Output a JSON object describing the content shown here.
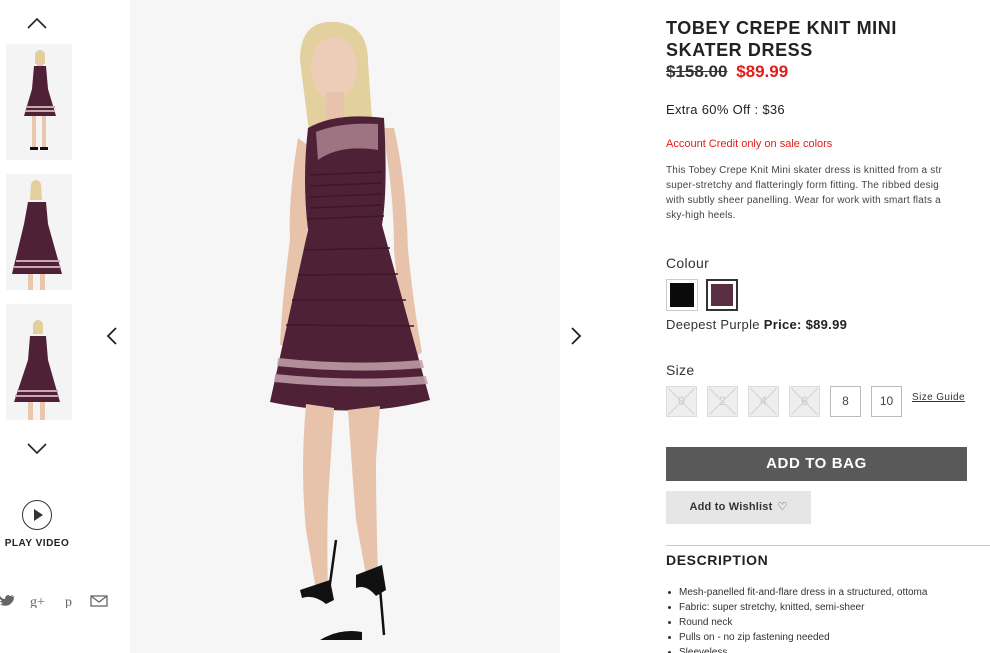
{
  "rail": {
    "icons": {
      "up": "chevron-up-icon",
      "down": "chevron-down-icon"
    },
    "thumbnails": [
      {
        "alt": "front-view"
      },
      {
        "alt": "side-view"
      },
      {
        "alt": "three-quarter-view"
      }
    ],
    "play_video_label": "PLAY VIDEO",
    "social_icons": [
      "twitter-icon",
      "google-plus-icon",
      "pinterest-icon",
      "email-icon"
    ]
  },
  "gallery": {
    "prev_icon": "chevron-left-icon",
    "next_icon": "chevron-right-icon"
  },
  "product": {
    "title_line1": "TOBEY CREPE KNIT MINI",
    "title_line2": "SKATER DRESS",
    "was_price": "$158.00",
    "now_price": "$89.99",
    "extra_offer": "Extra 60% Off : $36",
    "credit_note": "Account Credit only on sale colors",
    "blurb_lines": [
      "This Tobey Crepe Knit Mini skater dress is knitted from a str",
      "super-stretchy and flatteringly form fitting. The ribbed desig",
      "with subtly sheer panelling. Wear for work with smart flats a",
      "sky-high heels."
    ],
    "colour_label": "Colour",
    "colours": [
      {
        "name": "Black",
        "hex": "#0a0a0a"
      },
      {
        "name": "Deepest Purple",
        "hex": "#5a2f43"
      }
    ],
    "selected_colour": "Deepest Purple",
    "price_label": "Price:",
    "price_value": "$89.99",
    "size_label": "Size",
    "sizes": [
      {
        "label": "0",
        "available": false
      },
      {
        "label": "2",
        "available": false
      },
      {
        "label": "4",
        "available": false
      },
      {
        "label": "6",
        "available": false
      },
      {
        "label": "8",
        "available": true
      },
      {
        "label": "10",
        "available": true
      }
    ],
    "size_guide_label": "Size Guide",
    "add_to_bag_label": "ADD TO BAG",
    "wishlist_label": "Add to Wishlist",
    "wishlist_icon": "heart-icon",
    "description_heading": "DESCRIPTION",
    "bullets": [
      "Mesh-panelled fit-and-flare dress in a structured, ottoma",
      "Fabric: super stretchy, knitted, semi-sheer",
      "Round neck",
      "Pulls on - no zip fastening needed",
      "Sleeveless"
    ]
  },
  "colors": {
    "sale_red": "#e31c18",
    "button_dark": "#595959",
    "button_light": "#e6e6e6",
    "dress": "#4e2137"
  }
}
